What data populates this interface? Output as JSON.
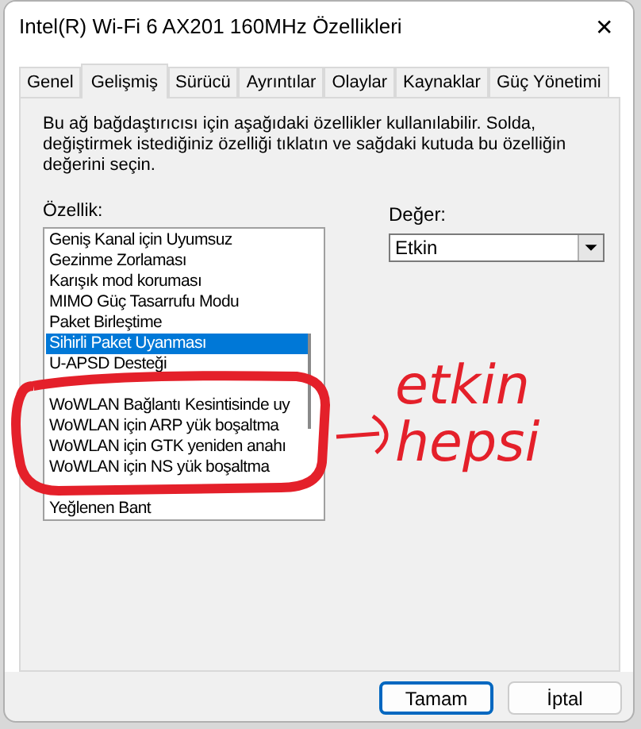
{
  "window": {
    "title": "Intel(R) Wi-Fi 6 AX201 160MHz Özellikleri",
    "close": "✕"
  },
  "tabs": [
    {
      "label": "Genel",
      "selected": false
    },
    {
      "label": "Gelişmiş",
      "selected": true
    },
    {
      "label": "Sürücü",
      "selected": false
    },
    {
      "label": "Ayrıntılar",
      "selected": false
    },
    {
      "label": "Olaylar",
      "selected": false
    },
    {
      "label": "Kaynaklar",
      "selected": false
    },
    {
      "label": "Güç Yönetimi",
      "selected": false
    }
  ],
  "description": "Bu ağ bağdaştırıcısı için aşağıdaki özellikler kullanılabilir. Solda, değiştirmek istediğiniz özelliği tıklatın ve sağdaki kutuda bu özelliğin değerini seçin.",
  "property": {
    "label": "Özellik:",
    "items": [
      {
        "kind": "item",
        "label": "Geniş Kanal için Uyumsuz",
        "selected": false
      },
      {
        "kind": "item",
        "label": "Gezinme Zorlaması",
        "selected": false
      },
      {
        "kind": "item",
        "label": "Karışık mod koruması",
        "selected": false
      },
      {
        "kind": "item",
        "label": "MIMO Güç Tasarrufu Modu",
        "selected": false
      },
      {
        "kind": "item",
        "label": "Paket Birleştime",
        "selected": false
      },
      {
        "kind": "item",
        "label": "Sihirli Paket Uyanması",
        "selected": true
      },
      {
        "kind": "item",
        "label": "U-APSD Desteği",
        "selected": false
      },
      {
        "kind": "covered"
      },
      {
        "kind": "item",
        "label": "WoWLAN Bağlantı Kesintisinde uy",
        "selected": false
      },
      {
        "kind": "item",
        "label": "WoWLAN için ARP yük boşaltma",
        "selected": false
      },
      {
        "kind": "item",
        "label": "WoWLAN için GTK yeniden anahı",
        "selected": false
      },
      {
        "kind": "item",
        "label": "WoWLAN için NS yük boşaltma",
        "selected": false
      },
      {
        "kind": "covered"
      },
      {
        "kind": "item",
        "label": "Yeğlenen Bant",
        "selected": false
      }
    ]
  },
  "value": {
    "label": "Değer:",
    "value": "Etkin"
  },
  "annotation": {
    "color": "#e4202a",
    "lines": [
      "etkin",
      "hepsi"
    ]
  },
  "buttons": [
    {
      "label": "Tamam",
      "default": true
    },
    {
      "label": "İptal",
      "default": false
    }
  ]
}
